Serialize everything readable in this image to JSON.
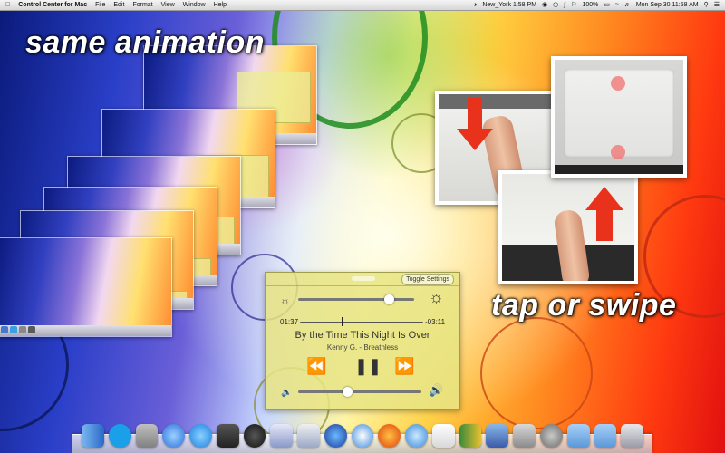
{
  "menubar": {
    "app_name": "Control Center for Mac",
    "menus": [
      "File",
      "Edit",
      "Format",
      "View",
      "Window",
      "Help"
    ],
    "clock_city": "New_York 1:58 PM",
    "battery": "100%",
    "datetime": "Mon Sep 30  11:58 AM"
  },
  "headline_left": "same animation",
  "headline_right": "tap or swipe",
  "player": {
    "toggle_label": "Toggle Settings",
    "brightness_level": 0.78,
    "elapsed": "01:37",
    "remaining": "-03:11",
    "track_progress": 0.34,
    "song": "By the Time This Night Is Over",
    "artist": "Kenny G. - Breathless",
    "volume_level": 0.4
  },
  "icons": {
    "apple": "apple-icon",
    "brightness_low": "sun-small-icon",
    "brightness_high": "sun-large-icon",
    "rewind": "rewind-icon",
    "pause": "pause-icon",
    "forward": "fast-forward-icon",
    "volume_low": "speaker-low-icon",
    "volume_high": "speaker-high-icon",
    "arrow_down": "red-down-arrow",
    "arrow_up": "red-up-arrow"
  },
  "colors": {
    "panel": "#e8e482",
    "arrow": "#e8321c"
  }
}
